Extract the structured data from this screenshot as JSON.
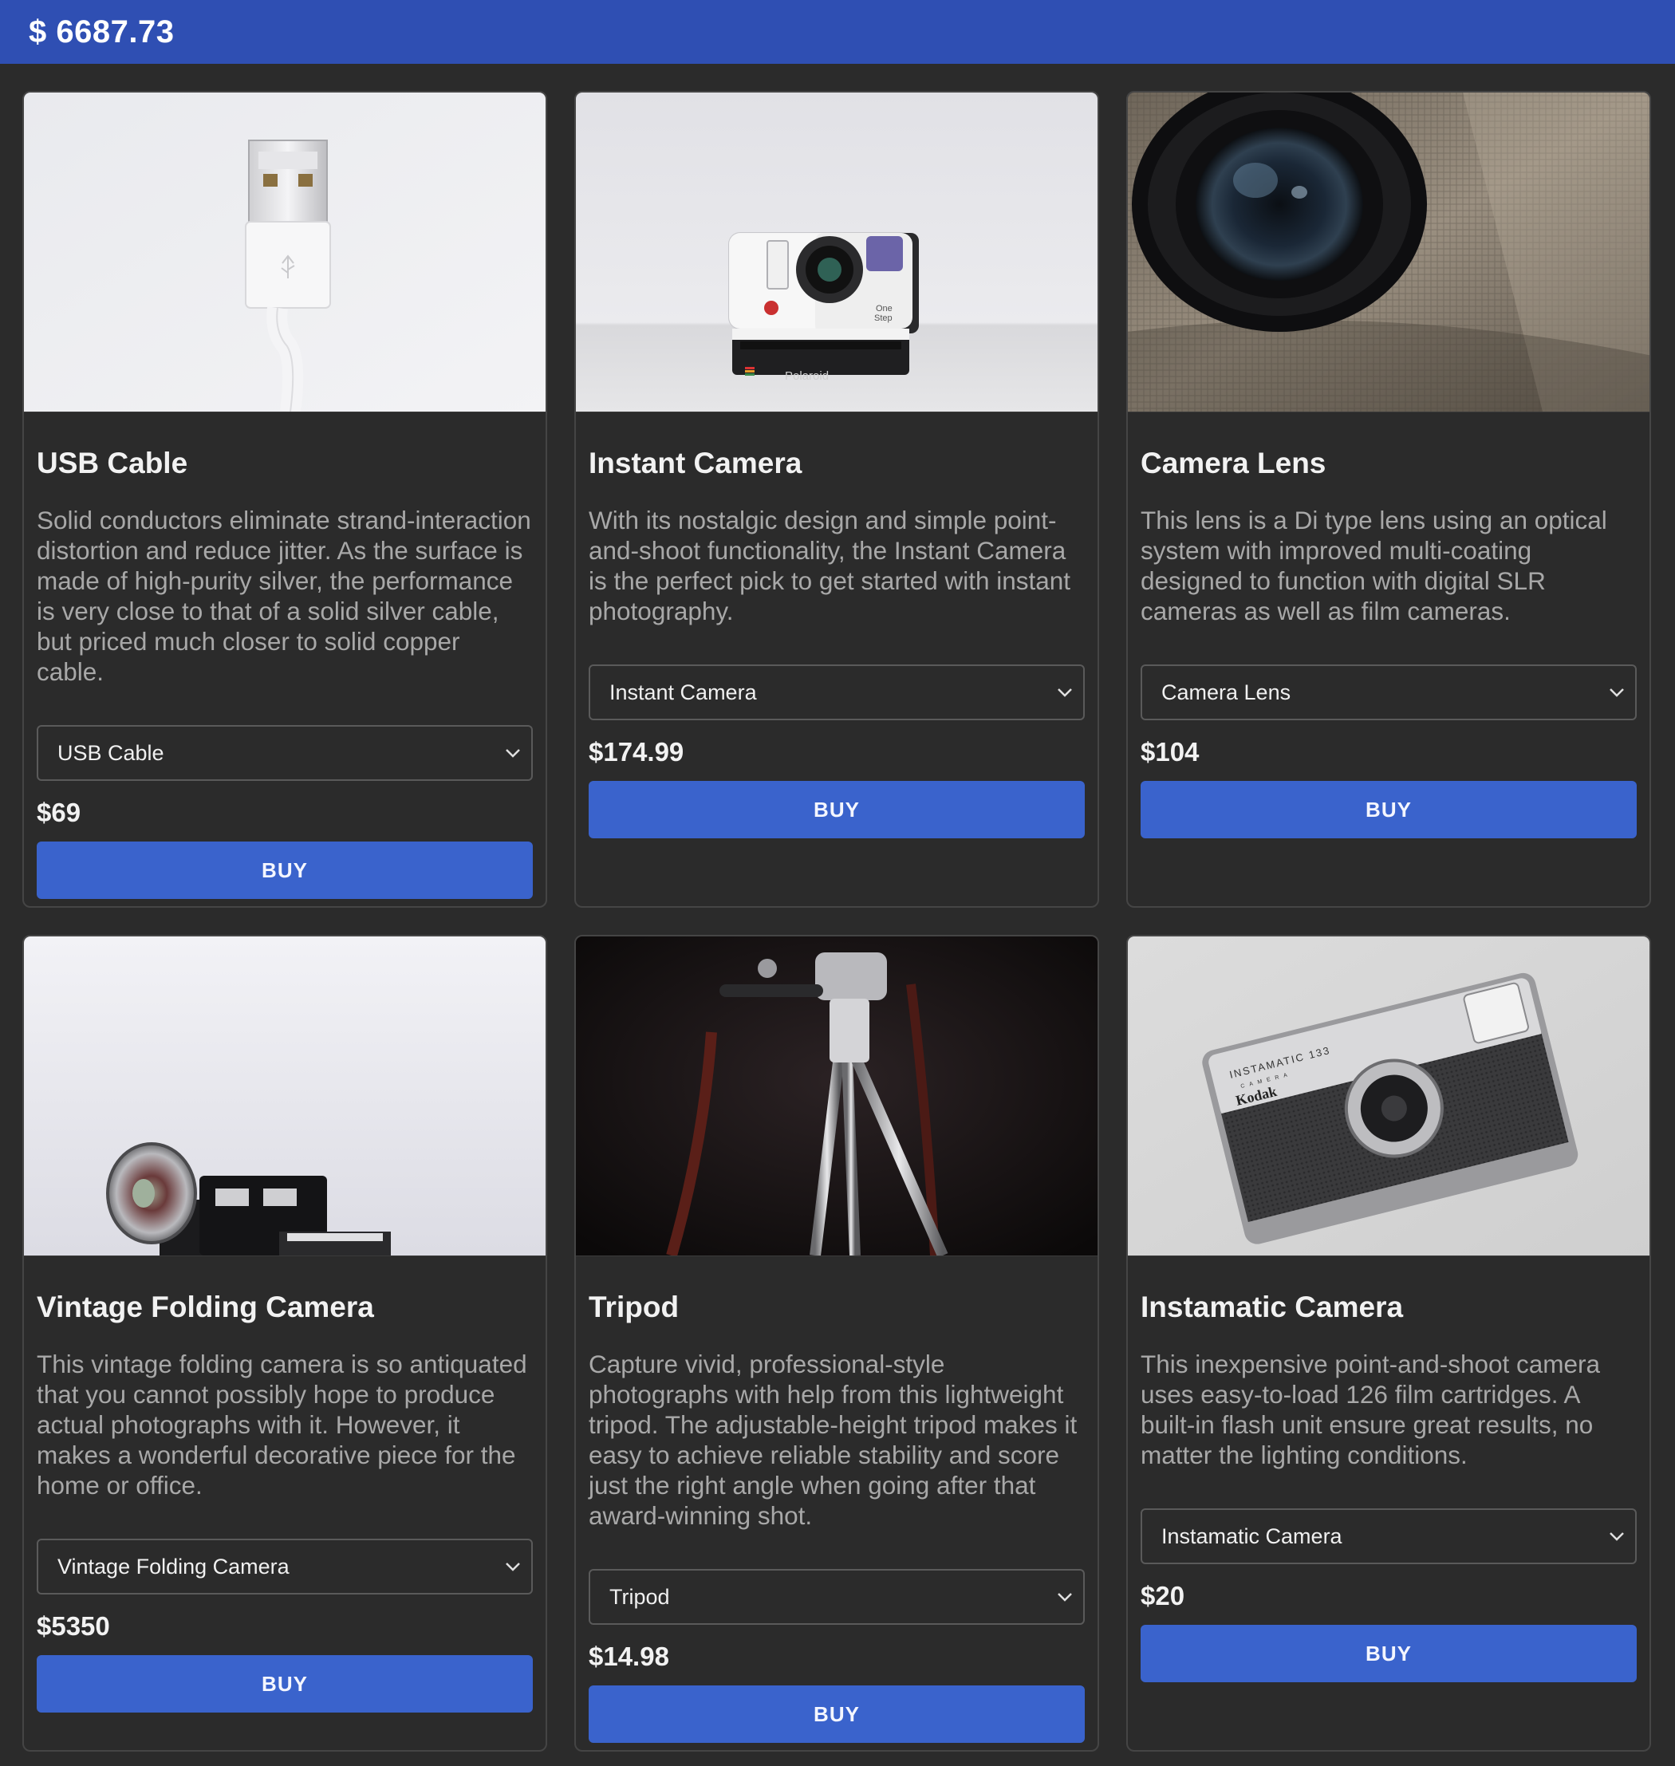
{
  "header": {
    "balance": "$ 6687.73"
  },
  "products": [
    {
      "title": "USB Cable",
      "description": "Solid conductors eliminate strand-interaction distortion and reduce jitter. As the surface is made of high-purity silver, the performance is very close to that of a solid silver cable, but priced much closer to solid copper cable.",
      "select_value": "USB Cable",
      "price": "$69",
      "buy_label": "BUY"
    },
    {
      "title": "Instant Camera",
      "description": "With its nostalgic design and simple point-and-shoot functionality, the Instant Camera is the perfect pick to get started with instant photography.",
      "select_value": "Instant Camera",
      "price": "$174.99",
      "buy_label": "BUY"
    },
    {
      "title": "Camera Lens",
      "description": "This lens is a Di type lens using an optical system with improved multi-coating designed to function with digital SLR cameras as well as film cameras.",
      "select_value": "Camera Lens",
      "price": "$104",
      "buy_label": "BUY"
    },
    {
      "title": "Vintage Folding Camera",
      "description": "This vintage folding camera is so antiquated that you cannot possibly hope to produce actual photographs with it. However, it makes a wonderful decorative piece for the home or office.",
      "select_value": "Vintage Folding Camera",
      "price": "$5350",
      "buy_label": "BUY"
    },
    {
      "title": "Tripod",
      "description": "Capture vivid, professional-style photographs with help from this lightweight tripod. The adjustable-height tripod makes it easy to achieve reliable stability and score just the right angle when going after that award-winning shot.",
      "select_value": "Tripod",
      "price": "$14.98",
      "buy_label": "BUY"
    },
    {
      "title": "Instamatic Camera",
      "description": "This inexpensive point-and-shoot camera uses easy-to-load 126 film cartridges. A built-in flash unit ensure great results, no matter the lighting conditions.",
      "select_value": "Instamatic Camera",
      "price": "$20",
      "buy_label": "BUY"
    }
  ],
  "image_text": {
    "polaroid_brand": "Polaroid",
    "polaroid_model_line1": "One",
    "polaroid_model_line2": "Step",
    "kodak_model": "INSTAMATIC 133",
    "kodak_subtitle": "CAMERA",
    "kodak_brand": "Kodak"
  }
}
